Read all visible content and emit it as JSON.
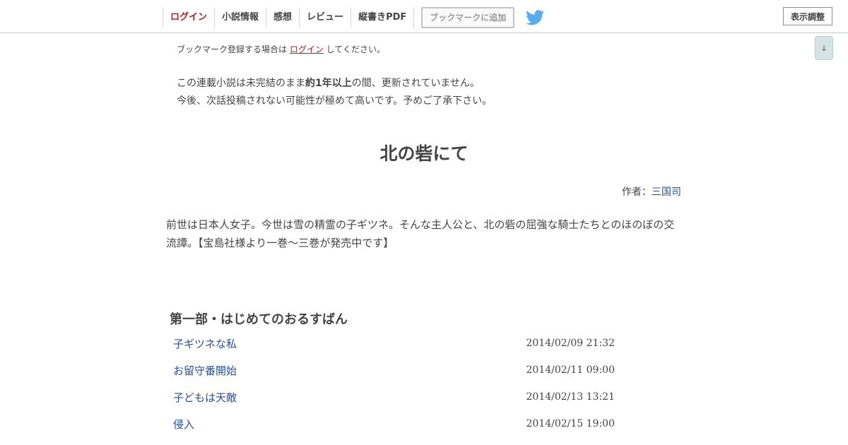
{
  "nav": {
    "items": [
      {
        "label": "ログイン",
        "name": "nav-login"
      },
      {
        "label": "小説情報",
        "name": "nav-novel-info"
      },
      {
        "label": "感想",
        "name": "nav-impressions"
      },
      {
        "label": "レビュー",
        "name": "nav-review"
      },
      {
        "label": "縦書きPDF",
        "name": "nav-vertical-pdf"
      }
    ],
    "bookmark_button": "ブックマークに追加",
    "twitter_icon": "twitter-bird-icon",
    "display_adjust": "表示調整",
    "scroll_down": "↓"
  },
  "bookmark_note": {
    "before": "ブックマーク登録する場合は ",
    "link": "ログイン",
    "after": " してください。"
  },
  "hiatus_notice": {
    "line1_before": "この連載小説は未完結のまま",
    "line1_bold": "約1年以上",
    "line1_after": "の間、更新されていません。",
    "line2": "今後、次話投稿されない可能性が極めて高いです。予めご了承下さい。"
  },
  "novel": {
    "title": "北の砦にて",
    "author_label": "作者：",
    "author_name": "三国司",
    "synopsis": "前世は日本人女子。今世は雪の精霊の子ギツネ。そんな主人公と、北の砦の屈強な騎士たちとのほのぼの交流譚。【宝島社様より一巻～三巻が発売中です】"
  },
  "chapter": {
    "title": "第一部・はじめてのおるすばん",
    "episodes": [
      {
        "title": "子ギツネな私",
        "date": "2014/02/09 21:32"
      },
      {
        "title": "お留守番開始",
        "date": "2014/02/11 09:00"
      },
      {
        "title": "子どもは天敵",
        "date": "2014/02/13 13:21"
      },
      {
        "title": "侵入",
        "date": "2014/02/15 19:00"
      }
    ]
  },
  "colors": {
    "accent_red": "#bb1b21",
    "link_blue": "#2a4f9a",
    "text": "#444444",
    "twitter_blue": "#55acee"
  }
}
